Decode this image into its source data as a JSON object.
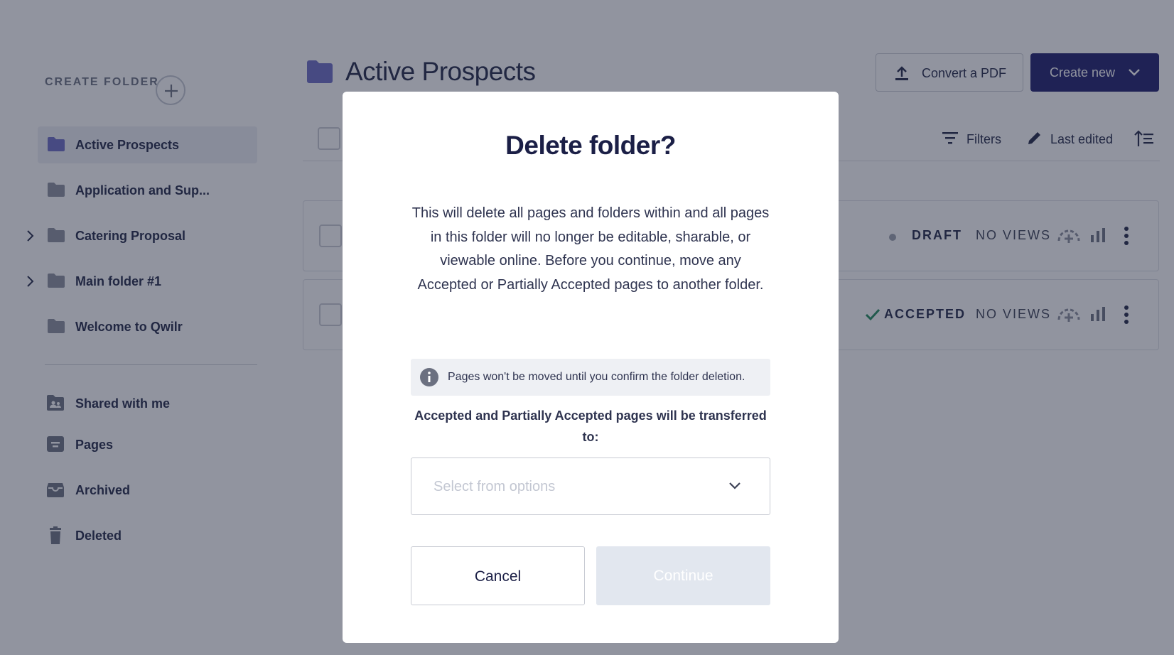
{
  "sidebar": {
    "create_folder_label": "CREATE FOLDER",
    "folders": [
      {
        "label": "Active Prospects",
        "active": true,
        "expandable": false
      },
      {
        "label": "Application and Sup...",
        "active": false,
        "expandable": false
      },
      {
        "label": "Catering Proposal",
        "active": false,
        "expandable": true
      },
      {
        "label": "Main folder #1",
        "active": false,
        "expandable": true
      },
      {
        "label": "Welcome to Qwilr",
        "active": false,
        "expandable": false
      }
    ],
    "nav": [
      {
        "label": "Shared with me",
        "icon": "shared-folder-icon"
      },
      {
        "label": "Pages",
        "icon": "pages-icon"
      },
      {
        "label": "Archived",
        "icon": "archive-icon"
      },
      {
        "label": "Deleted",
        "icon": "trash-icon"
      }
    ]
  },
  "header": {
    "title": "Active Prospects",
    "convert_label": "Convert a PDF",
    "create_label": "Create new"
  },
  "toolbar": {
    "filters_label": "Filters",
    "sort_label": "Last edited"
  },
  "rows": [
    {
      "status": "DRAFT",
      "views": "NO VIEWS"
    },
    {
      "status": "ACCEPTED",
      "views": "NO VIEWS"
    }
  ],
  "modal": {
    "title": "Delete folder?",
    "body": "This will delete all pages and folders within and all pages in this folder will no longer be editable, sharable, or viewable online. Before you continue, move any Accepted or Partially Accepted pages to another folder.",
    "info": "Pages won't be moved until you confirm the folder deletion.",
    "transfer_label": "Accepted and Partially Accepted pages will be transferred to:",
    "select_placeholder": "Select from options",
    "cancel_label": "Cancel",
    "continue_label": "Continue"
  },
  "colors": {
    "brand": "#1b1a6b",
    "folder_active": "#6a6bc4",
    "folder": "#8b8f9c",
    "accepted": "#1f8a5b",
    "overlay": "rgba(36,42,63,0.5)"
  }
}
